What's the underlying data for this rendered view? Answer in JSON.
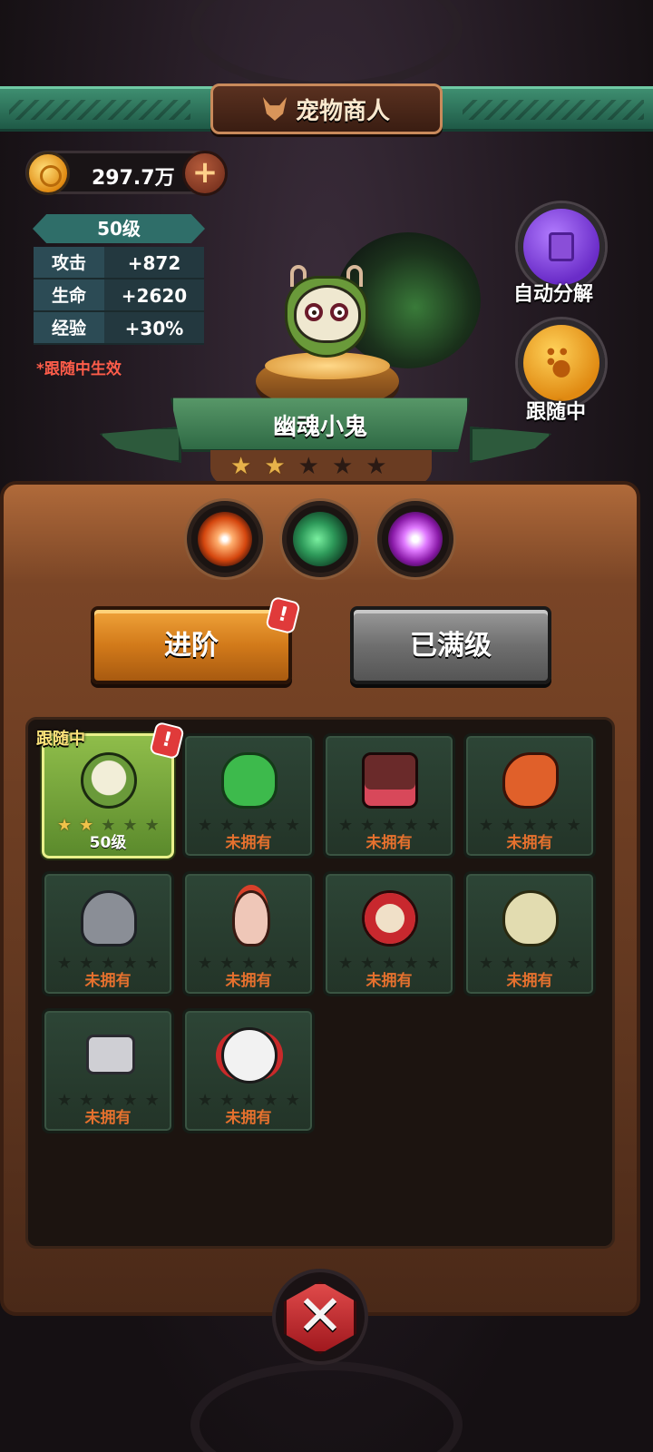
{
  "header": {
    "title": "宠物商人",
    "title_icon": "fox-icon"
  },
  "currency": {
    "amount": "297.7万",
    "icon": "coin-icon",
    "add_icon": "plus-icon"
  },
  "pet_stats": {
    "level": "50级",
    "rows": [
      {
        "label": "攻击",
        "value": "+872"
      },
      {
        "label": "生命",
        "value": "+2620"
      },
      {
        "label": "经验",
        "value": "+30%"
      }
    ],
    "note": "*跟随中生效"
  },
  "side_buttons": {
    "auto_decompose": {
      "label": "自动分解",
      "icon": "decompose-icon",
      "color": "#7a3ae0"
    },
    "following": {
      "label": "跟随中",
      "icon": "paw-icon",
      "color": "#f0a020"
    }
  },
  "selected_pet": {
    "name": "幽魂小鬼",
    "stars_filled": 2,
    "stars_total": 5
  },
  "skills": [
    {
      "name": "burst-skill-icon"
    },
    {
      "name": "slash-skill-icon"
    },
    {
      "name": "chat-skill-icon"
    }
  ],
  "actions": {
    "advance": {
      "label": "进阶",
      "alert": "!"
    },
    "maxed": {
      "label": "已满级"
    }
  },
  "pet_list": {
    "following_tag": "跟随中",
    "items": [
      {
        "sprite": "ghost",
        "status": "50级",
        "stars_filled": 2,
        "active": true,
        "alert": "!"
      },
      {
        "sprite": "duck",
        "status": "未拥有",
        "stars_filled": 0
      },
      {
        "sprite": "chest",
        "status": "未拥有",
        "stars_filled": 0
      },
      {
        "sprite": "dragon",
        "status": "未拥有",
        "stars_filled": 0
      },
      {
        "sprite": "knight",
        "status": "未拥有",
        "stars_filled": 0
      },
      {
        "sprite": "chicken",
        "status": "未拥有",
        "stars_filled": 0
      },
      {
        "sprite": "daruma",
        "status": "未拥有",
        "stars_filled": 0
      },
      {
        "sprite": "egg",
        "status": "未拥有",
        "stars_filled": 0
      },
      {
        "sprite": "glove",
        "status": "未拥有",
        "stars_filled": 0
      },
      {
        "sprite": "clown",
        "status": "未拥有",
        "stars_filled": 0
      }
    ]
  },
  "close": {
    "icon": "close-icon",
    "glyph": "✕"
  }
}
